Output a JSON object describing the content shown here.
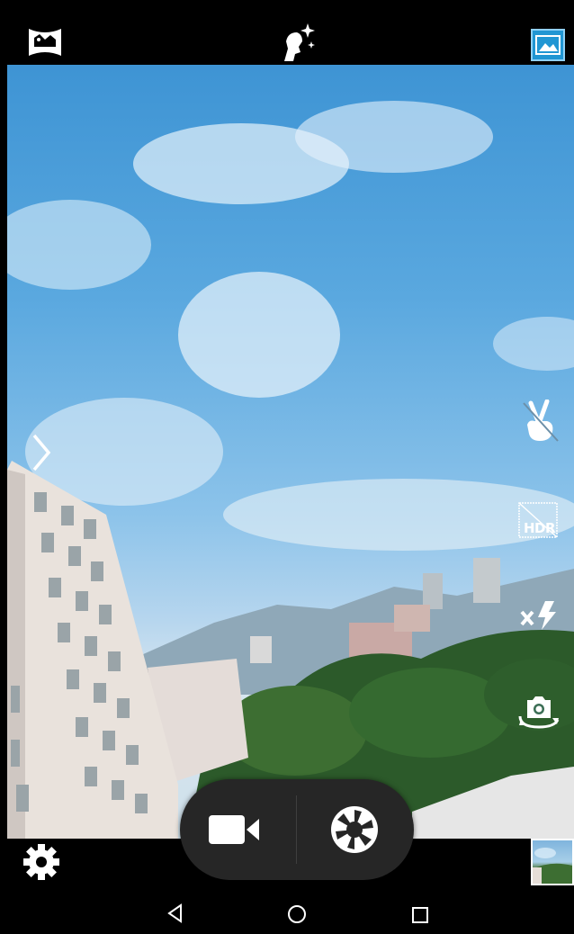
{
  "app": "Camera",
  "top_bar": {
    "icons": [
      "panorama-icon",
      "beauty-mode-icon",
      "gallery-icon"
    ]
  },
  "side_controls": {
    "icons": [
      "gesture-shot-icon",
      "hdr-off-icon",
      "flash-off-icon",
      "switch-camera-icon"
    ],
    "hdr_label": "HDR"
  },
  "capture_controls": {
    "icons": [
      "video-record-icon",
      "shutter-icon"
    ]
  },
  "bottom_bar": {
    "icons": [
      "settings-icon",
      "last-photo-thumbnail"
    ]
  },
  "nav_bar": {
    "icons": [
      "back-icon",
      "home-icon",
      "recents-icon"
    ]
  },
  "colors": {
    "bar_background": "#000000",
    "pill_background": "#262626",
    "gallery_accent": "#2196d3",
    "icon": "#ffffff"
  }
}
